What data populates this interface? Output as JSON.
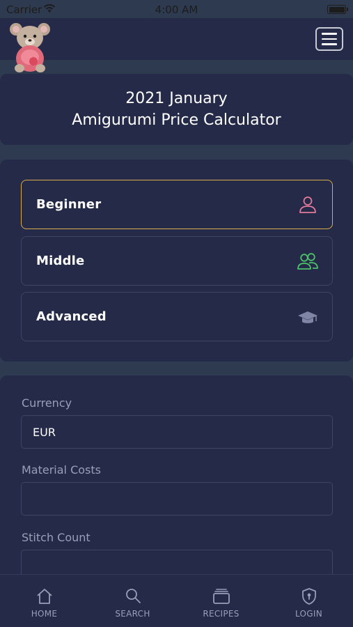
{
  "status_bar": {
    "carrier": "Carrier",
    "time": "4:00 AM"
  },
  "header": {
    "logo": "teddy-bear-logo",
    "menu_icon": "hamburger-menu-icon"
  },
  "title_card": {
    "line1": "2021 January",
    "line2": "Amigurumi Price Calculator"
  },
  "levels": [
    {
      "label": "Beginner",
      "icon": "user-icon",
      "icon_color": "#e27a9a",
      "selected": true
    },
    {
      "label": "Middle",
      "icon": "users-icon",
      "icon_color": "#4cc46a",
      "selected": false
    },
    {
      "label": "Advanced",
      "icon": "graduation-cap-icon",
      "icon_color": "#7f86a6",
      "selected": false
    }
  ],
  "form": {
    "currency": {
      "label": "Currency",
      "value": "EUR"
    },
    "material_costs": {
      "label": "Material Costs",
      "value": ""
    },
    "stitch_count": {
      "label": "Stitch Count",
      "value": ""
    }
  },
  "tabs": [
    {
      "label": "HOME",
      "icon": "home-icon"
    },
    {
      "label": "SEARCH",
      "icon": "search-icon"
    },
    {
      "label": "RECIPES",
      "icon": "recipes-icon"
    },
    {
      "label": "LOGIN",
      "icon": "shield-lock-icon"
    }
  ],
  "colors": {
    "background": "#2e3a4f",
    "card": "#252a48",
    "accent_selected_border": "#d9ad4a",
    "muted_text": "#9a9fb8"
  }
}
